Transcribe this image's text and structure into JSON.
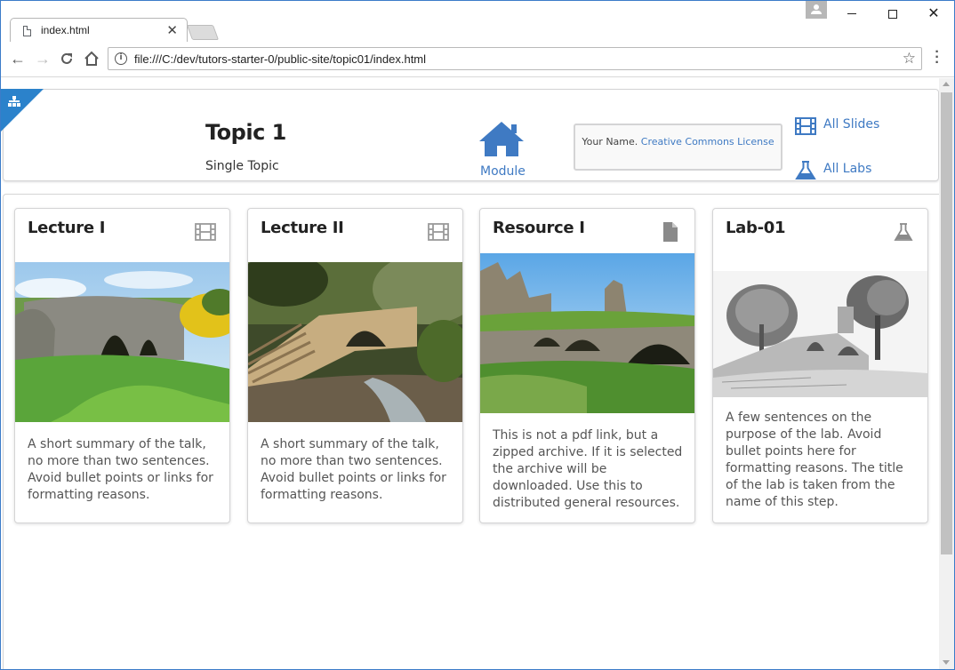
{
  "browser": {
    "tab_title": "index.html",
    "url": "file:///C:/dev/tutors-starter-0/public-site/topic01/index.html"
  },
  "header": {
    "title": "Topic 1",
    "subtitle": "Single Topic",
    "module_label": "Module",
    "license_prefix": "Your Name.",
    "license_link": "Creative Commons License",
    "all_slides": "All Slides",
    "all_labs": "All Labs"
  },
  "cards": [
    {
      "title": "Lecture I",
      "icon": "film-icon",
      "description": "A short summary of the talk, no more than two sentences. Avoid bullet points or links for formatting reasons."
    },
    {
      "title": "Lecture II",
      "icon": "film-icon",
      "description": "A short summary of the talk, no more than two sentences. Avoid bullet points or links for formatting reasons."
    },
    {
      "title": "Resource I",
      "icon": "file-icon",
      "description": "This is not a pdf link, but a zipped archive. If it is selected the archive will be downloaded. Use this to distributed general resources."
    },
    {
      "title": "Lab-01",
      "icon": "flask-icon",
      "description": "A few sentences on the purpose of the lab. Avoid bullet points here for formatting reasons. The title of the lab is taken from the name of this step."
    }
  ],
  "colors": {
    "accent": "#3f7ac3",
    "corner": "#2b82cb"
  }
}
